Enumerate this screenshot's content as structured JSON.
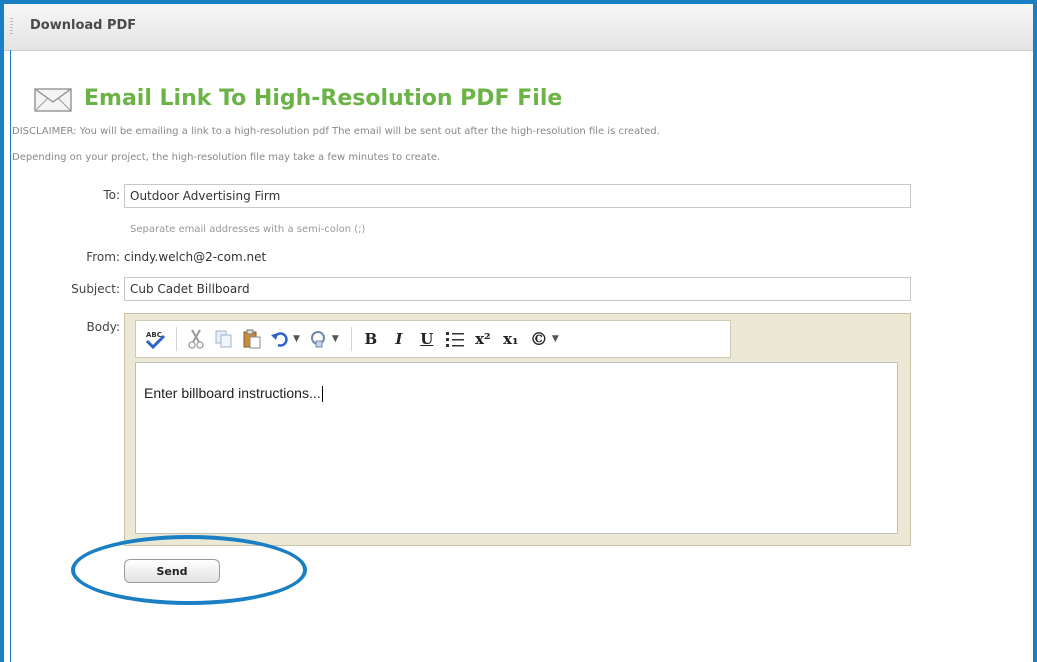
{
  "window": {
    "title": "Download PDF"
  },
  "heading": {
    "text": "Email Link To High-Resolution PDF File"
  },
  "disclaimer": {
    "line1": "DISCLAIMER: You will be emailing a link to a high-resolution pdf The email will be sent out after the high-resolution file is created.",
    "line2": "Depending on your project, the high-resolution file may take a few minutes to create."
  },
  "form": {
    "to": {
      "label": "To:",
      "value": "Outdoor Advertising Firm",
      "hint": "Separate email addresses with a semi-colon (;)"
    },
    "from": {
      "label": "From:",
      "value": "cindy.welch@2-com.net"
    },
    "subject": {
      "label": "Subject:",
      "value": "Cub Cadet Billboard"
    },
    "body": {
      "label": "Body:",
      "value": "Enter billboard instructions..."
    },
    "send_label": "Send"
  },
  "toolbar": {
    "bold": "B",
    "italic": "I",
    "underline": "U",
    "superscript": "x²",
    "subscript": "x₁",
    "copyright": "©"
  },
  "colors": {
    "accent": "#1b7fc4",
    "heading": "#6cb347"
  }
}
